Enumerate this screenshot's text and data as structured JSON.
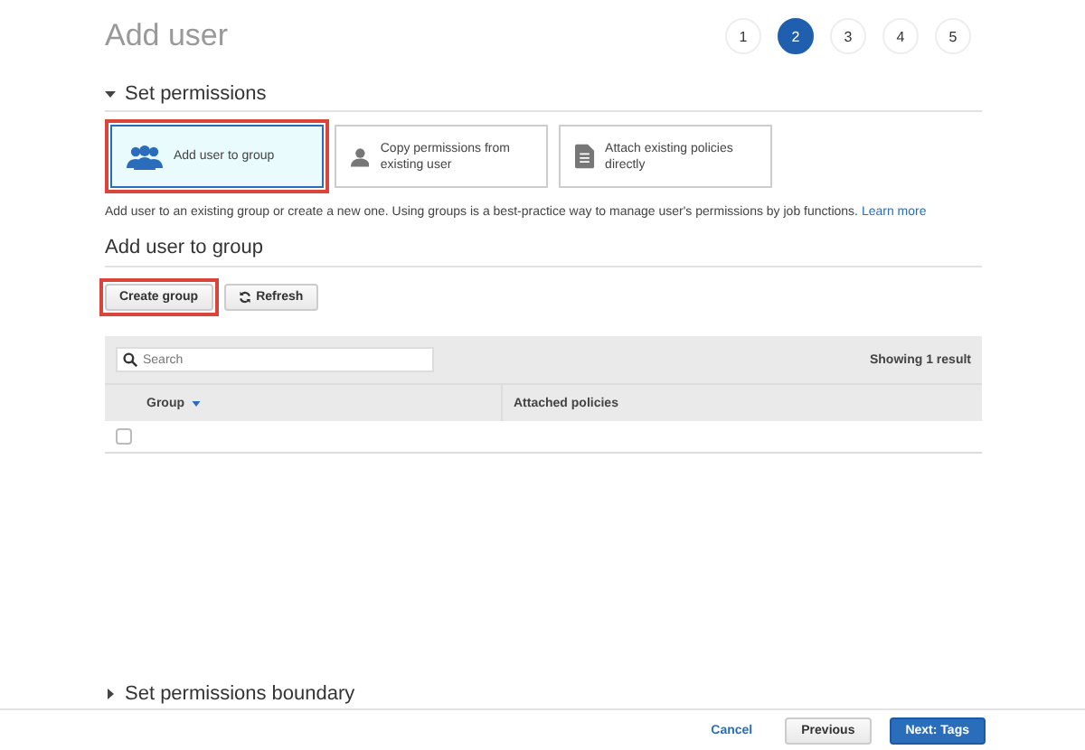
{
  "title": "Add user",
  "steps": [
    {
      "label": "1",
      "selected": false
    },
    {
      "label": "2",
      "selected": true
    },
    {
      "label": "3",
      "selected": false
    },
    {
      "label": "4",
      "selected": false
    },
    {
      "label": "5",
      "selected": false
    }
  ],
  "permissions": {
    "heading": "Set permissions",
    "expanded": true,
    "options": [
      {
        "kind": "group",
        "label": "Add user to group",
        "selected": true,
        "highlighted": true
      },
      {
        "kind": "user",
        "label": "Copy permissions from existing user",
        "selected": false,
        "highlighted": false
      },
      {
        "kind": "policy",
        "label": "Attach existing policies directly",
        "selected": false,
        "highlighted": false
      }
    ],
    "description": "Add user to an existing group or create a new one. Using groups is a best-practice way to manage user's permissions by job functions.",
    "link": "Learn more"
  },
  "group_section": {
    "heading": "Add user to group",
    "buttons": [
      {
        "kind": "create",
        "label": "Create group",
        "highlighted": true
      },
      {
        "kind": "refresh",
        "label": "Refresh",
        "highlighted": false
      }
    ],
    "search": {
      "placeholder": "Search"
    },
    "result_count": "Showing 1 result",
    "columns": [
      {
        "label": "Group",
        "sorted": true
      },
      {
        "label": "Attached policies",
        "sorted": false
      }
    ],
    "rows": [
      {
        "checked": false
      }
    ]
  },
  "boundary": {
    "heading": "Set permissions boundary",
    "expanded": false
  },
  "footer": {
    "cancel": "Cancel",
    "previous": "Previous",
    "next": "Next: Tags"
  }
}
